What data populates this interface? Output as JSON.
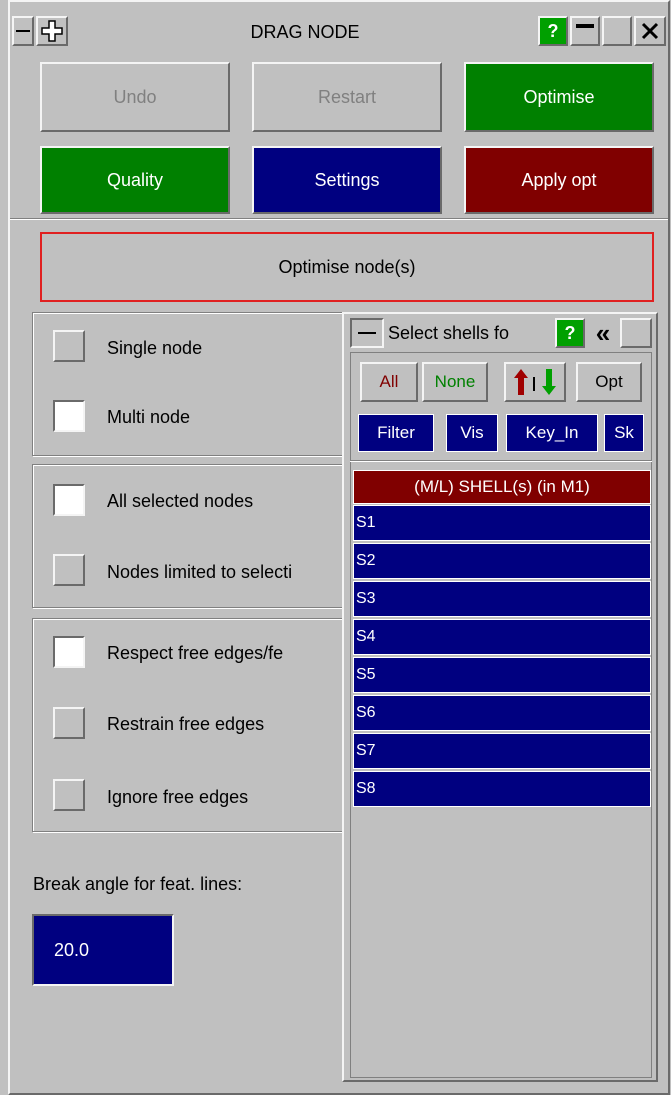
{
  "window": {
    "title": "DRAG NODE",
    "help_label": "?",
    "colors": {
      "green": "#008000",
      "navy": "#000080",
      "maroon": "#800000",
      "help_green": "#00a000"
    }
  },
  "actions": {
    "undo": "Undo",
    "restart": "Restart",
    "optimise": "Optimise",
    "quality": "Quality",
    "settings": "Settings",
    "apply_opt": "Apply opt",
    "optimise_nodes": "Optimise node(s)"
  },
  "node_mode": {
    "single": {
      "label": "Single node",
      "checked": false
    },
    "multi": {
      "label": "Multi node",
      "checked": true
    }
  },
  "selection_scope": {
    "all": {
      "label": "All selected nodes",
      "checked": true
    },
    "limited": {
      "label": "Nodes limited to selecti",
      "checked": false
    }
  },
  "free_edges": {
    "respect": {
      "label": "Respect free edges/fe",
      "checked": true
    },
    "restrain": {
      "label": "Restrain free edges",
      "checked": false
    },
    "ignore": {
      "label": "Ignore free edges",
      "checked": false
    }
  },
  "break_angle": {
    "label": "Break angle for feat. lines:",
    "value": "20.0"
  },
  "select_panel": {
    "title": "Select shells fo",
    "help_label": "?",
    "collapse_glyph": "«",
    "buttons": {
      "all": "All",
      "none": "None",
      "opt": "Opt",
      "filter": "Filter",
      "vis": "Vis",
      "key_in": "Key_In",
      "sk": "Sk"
    },
    "list_header": "(M/L) SHELL(s) (in M1)",
    "items": [
      "S1",
      "S2",
      "S3",
      "S4",
      "S5",
      "S6",
      "S7",
      "S8"
    ]
  }
}
